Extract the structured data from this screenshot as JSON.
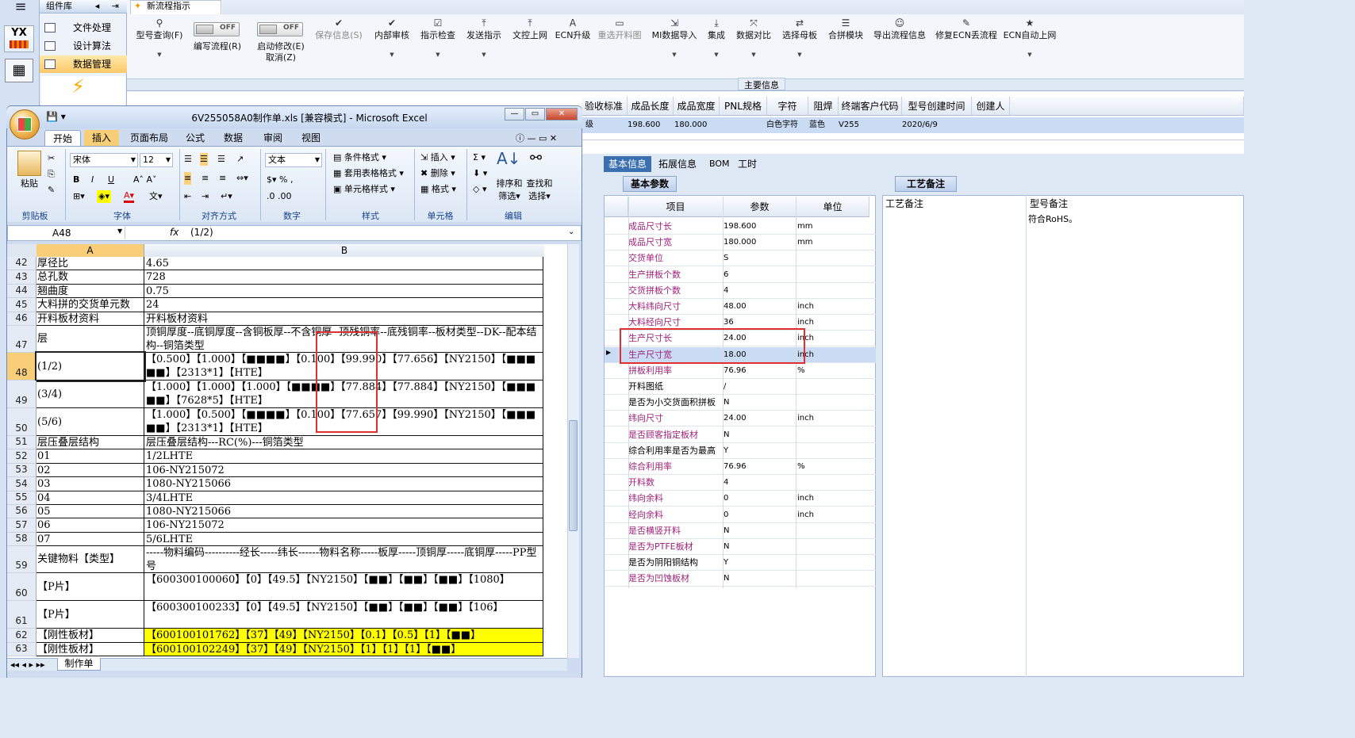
{
  "app": {
    "hamburger": "≡",
    "logo_text": "YX",
    "component_panel_title": "组件库",
    "component_items": [
      "文件处理",
      "设计算法",
      "数据管理"
    ],
    "new_flow_label": "新流程指示",
    "active_tab": "新流程指示"
  },
  "toolbar": [
    {
      "label": "型号查询(F)",
      "icon": "search-icon",
      "enabled": true
    },
    {
      "label": "编写流程(R)",
      "icon": "toggle-off",
      "enabled": true,
      "toggle": "OFF"
    },
    {
      "label": "启动修改(E)",
      "label2": "取消(Z)",
      "icon": "toggle-off",
      "enabled": true,
      "toggle": "OFF"
    },
    {
      "label": "保存信息(S)",
      "icon": "check-icon",
      "enabled": false
    },
    {
      "label": "内部审核",
      "icon": "check-icon",
      "enabled": true
    },
    {
      "label": "指示检查",
      "icon": "checklist-icon",
      "enabled": true
    },
    {
      "label": "发送指示",
      "icon": "upload-icon",
      "enabled": true
    },
    {
      "label": "文控上网",
      "icon": "upload-icon",
      "enabled": true
    },
    {
      "label": "ECN升级",
      "icon": "a-icon",
      "enabled": true
    },
    {
      "label": "重选开料图",
      "icon": "image-icon",
      "enabled": false
    },
    {
      "label": "MI数据导入",
      "icon": "import-icon",
      "enabled": true
    },
    {
      "label": "集成",
      "icon": "download-icon",
      "enabled": true
    },
    {
      "label": "数据对比",
      "icon": "compare-icon",
      "enabled": true
    },
    {
      "label": "选择母板",
      "icon": "shuffle-icon",
      "enabled": true
    },
    {
      "label": "合拼模块",
      "icon": "list-icon",
      "enabled": true
    },
    {
      "label": "导出流程信息",
      "icon": "smile-icon",
      "enabled": true
    },
    {
      "label": "修复ECN丢流程",
      "icon": "wrench-icon",
      "enabled": true
    },
    {
      "label": "ECN自动上网",
      "icon": "star-icon",
      "enabled": true
    }
  ],
  "main_info": {
    "header": "主要信息",
    "columns": [
      "验收标准",
      "成品长度",
      "成品宽度",
      "PNL规格",
      "字符",
      "阻焊",
      "终端客户代码",
      "型号创建时间",
      "创建人"
    ],
    "row": {
      "验收标准": "级",
      "成品长度": "198.600",
      "成品宽度": "180.000",
      "PNL规格": "",
      "字符": "白色字符",
      "阻焊": "蓝色",
      "终端客户代码": "V255",
      "型号创建时间": "2020/6/9",
      "创建人": ""
    }
  },
  "detail_tabs": [
    "基本信息",
    "拓展信息",
    "BOM",
    "工时"
  ],
  "basic_params": {
    "tab": "基本参数",
    "columns": [
      "项目",
      "参数",
      "单位"
    ],
    "rows": [
      {
        "item": "成品尺寸长",
        "value": "198.600",
        "unit": "mm",
        "magenta": true
      },
      {
        "item": "成品尺寸宽",
        "value": "180.000",
        "unit": "mm",
        "magenta": true
      },
      {
        "item": "交货单位",
        "value": "S",
        "unit": "",
        "magenta": true
      },
      {
        "item": "生产拼板个数",
        "value": "6",
        "unit": "",
        "magenta": true
      },
      {
        "item": "交货拼板个数",
        "value": "4",
        "unit": "",
        "magenta": true
      },
      {
        "item": "大料纬向尺寸",
        "value": "48.00",
        "unit": "inch",
        "magenta": true
      },
      {
        "item": "大料经向尺寸",
        "value": "36",
        "unit": "inch",
        "magenta": true
      },
      {
        "item": "生产尺寸长",
        "value": "24.00",
        "unit": "inch",
        "magenta": true
      },
      {
        "item": "生产尺寸宽",
        "value": "18.00",
        "unit": "inch",
        "magenta": true,
        "selected": true
      },
      {
        "item": "拼板利用率",
        "value": "76.96",
        "unit": "%",
        "magenta": true
      },
      {
        "item": "开料图纸",
        "value": "/",
        "unit": "",
        "magenta": false
      },
      {
        "item": "是否为小交货面积拼板",
        "value": "N",
        "unit": "",
        "magenta": false
      },
      {
        "item": "纬向尺寸",
        "value": "24.00",
        "unit": "inch",
        "magenta": true
      },
      {
        "item": "是否顾客指定板材",
        "value": "N",
        "unit": "",
        "magenta": true
      },
      {
        "item": "综合利用率是否为最高",
        "value": "Y",
        "unit": "",
        "magenta": false
      },
      {
        "item": "综合利用率",
        "value": "76.96",
        "unit": "%",
        "magenta": true
      },
      {
        "item": "开料数",
        "value": "4",
        "unit": "",
        "magenta": true
      },
      {
        "item": "纬向余料",
        "value": "0",
        "unit": "inch",
        "magenta": true
      },
      {
        "item": "经向余料",
        "value": "0",
        "unit": "inch",
        "magenta": true
      },
      {
        "item": "是否横竖开料",
        "value": "N",
        "unit": "",
        "magenta": true
      },
      {
        "item": "是否为PTFE板材",
        "value": "N",
        "unit": "",
        "magenta": true
      },
      {
        "item": "是否为阴阳铜结构",
        "value": "Y",
        "unit": "",
        "magenta": false
      },
      {
        "item": "是否为凹蚀板材",
        "value": "N",
        "unit": "",
        "magenta": true
      }
    ]
  },
  "process_notes": {
    "tab": "工艺备注",
    "col1": "工艺备注",
    "col2": "型号备注",
    "model_note": "符合RoHS。"
  },
  "excel": {
    "title": "6V255058A0制作单.xls [兼容模式] - Microsoft Excel",
    "tabs": [
      "开始",
      "插入",
      "页面布局",
      "公式",
      "数据",
      "审阅",
      "视图"
    ],
    "font_name": "宋体",
    "font_size": "12",
    "number_format": "文本",
    "groups": [
      "剪贴板",
      "字体",
      "对齐方式",
      "数字",
      "样式",
      "单元格",
      "编辑"
    ],
    "clipboard": {
      "paste": "粘贴"
    },
    "styles": [
      "条件格式",
      "套用表格格式",
      "单元格样式"
    ],
    "cells_group": [
      "插入",
      "删除",
      "格式"
    ],
    "edit_group": [
      "排序和",
      "筛选",
      "查找和",
      "选择"
    ],
    "name_box": "A48",
    "formula": "(1/2)",
    "col_a": "A",
    "col_b": "B",
    "sheet_tab": "制作单",
    "rows": [
      {
        "n": "42",
        "a": "厚径比",
        "b": "4.65"
      },
      {
        "n": "43",
        "a": "总孔数",
        "b": "728"
      },
      {
        "n": "44",
        "a": "翘曲度",
        "b": "0.75"
      },
      {
        "n": "45",
        "a": "大料拼的交货单元数",
        "b": "24"
      },
      {
        "n": "46",
        "a": "开料板材资料",
        "b": "开料板材资料"
      },
      {
        "n": "47",
        "a": "层",
        "b": "顶铜厚度--底铜厚度--含铜板厚--不含铜厚--顶残铜率--底残铜率--板材类型--DK--配本结构--铜箔类型"
      },
      {
        "n": "48",
        "a": "(1/2)",
        "b": "【0.500】【1.000】【■■■■】【0.100】【99.990】【77.656】【NY2150】【■■■■■】【2313*1】【HTE】"
      },
      {
        "n": "49",
        "a": "(3/4)",
        "b": "【1.000】【1.000】【1.000】【■■■■】【77.884】【77.884】【NY2150】【■■■■■】【7628*5】【HTE】"
      },
      {
        "n": "50",
        "a": "(5/6)",
        "b": "【1.000】【0.500】【■■■■】【0.100】【77.657】【99.990】【NY2150】【■■■■■】【2313*1】【HTE】"
      },
      {
        "n": "51",
        "a": "层压叠层结构",
        "b": "层压叠层结构---RC(%)---铜箔类型"
      },
      {
        "n": "52",
        "a": "01",
        "b": "1/2LHTE"
      },
      {
        "n": "53",
        "a": "02",
        "b": "106-NY215072"
      },
      {
        "n": "54",
        "a": "03",
        "b": "1080-NY215066"
      },
      {
        "n": "55",
        "a": "04",
        "b": "3/4LHTE"
      },
      {
        "n": "56",
        "a": "05",
        "b": "1080-NY215066"
      },
      {
        "n": "57",
        "a": "06",
        "b": "106-NY215072"
      },
      {
        "n": "58",
        "a": "07",
        "b": "5/6LHTE"
      },
      {
        "n": "59",
        "a": "关键物料【类型】",
        "b": "-----物料编码----------经长-----纬长------物料名称-----板厚-----顶铜厚-----底铜厚-----PP型号"
      },
      {
        "n": "60",
        "a": "【P片】",
        "b": "【600300100060】【0】【49.5】【NY2150】【■■】【■■】【■■】【1080】"
      },
      {
        "n": "61",
        "a": "【P片】",
        "b": "【600300100233】【0】【49.5】【NY2150】【■■】【■■】【■■】【106】"
      },
      {
        "n": "62",
        "a": "【刚性板材】",
        "b": "【600100101762】【37】【49】【NY2150】【0.1】【0.5】【1】【■■】"
      },
      {
        "n": "63",
        "a": "【刚性板材】",
        "b": "【600100102249】【37】【49】【NY2150】【1】【1】【1】【■■】"
      }
    ]
  },
  "colors": {
    "accent": "#3a6fb0",
    "magenta": "#a0207a",
    "highlight": "#e03030",
    "yellow": "#ffff00"
  }
}
